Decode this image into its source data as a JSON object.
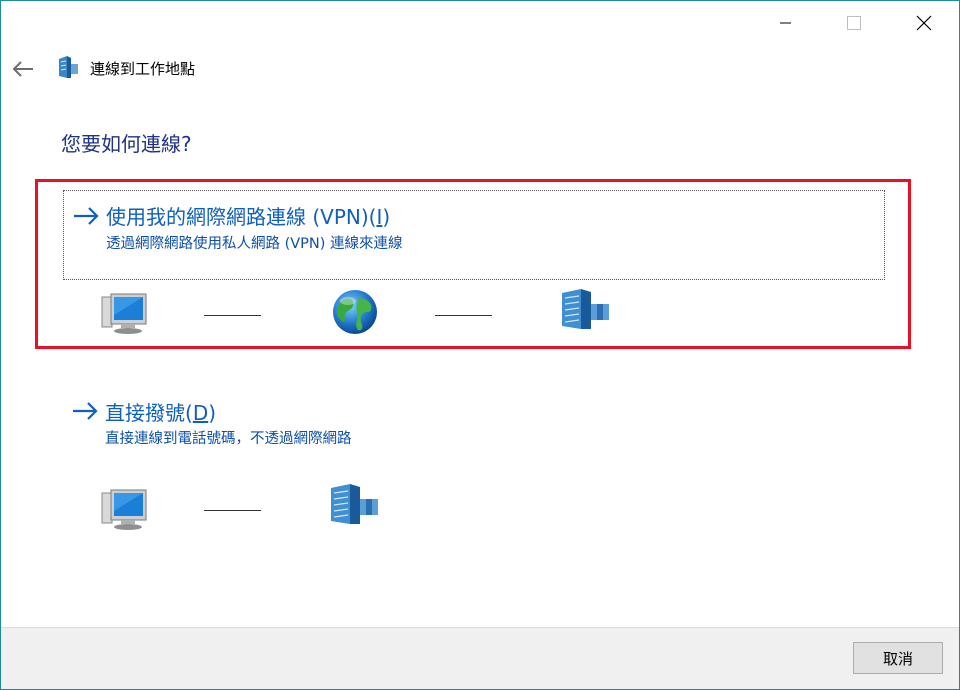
{
  "window": {
    "title": "連線到工作地點",
    "heading": "您要如何連線?"
  },
  "options": [
    {
      "title_main": "使用我的網際網路連線 (VPN)(",
      "accel": "I",
      "title_end": ")",
      "description": "透過網際網路使用私人網路 (VPN) 連線來連線"
    },
    {
      "title_main": "直接撥號(",
      "accel": "D",
      "title_end": ")",
      "description": "直接連線到電話號碼，不透過網際網路"
    }
  ],
  "footer": {
    "cancel_label": "取消"
  },
  "colors": {
    "heading": "#1e3287",
    "link": "#0e5fbe",
    "highlight_border": "#e81123",
    "window_border": "#1e8a9e"
  },
  "icons": {
    "back": "arrow-left-icon",
    "wizard": "workplace-building-icon",
    "computer": "computer-monitor-icon",
    "internet": "globe-icon",
    "workplace": "office-building-icon",
    "option_arrow": "arrow-right-icon"
  }
}
